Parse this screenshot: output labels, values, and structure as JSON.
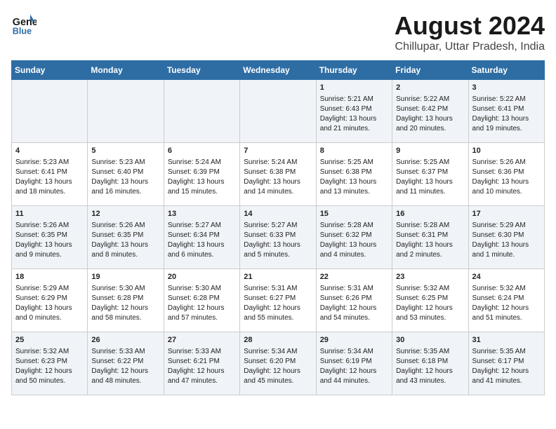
{
  "header": {
    "logo_line1": "General",
    "logo_line2": "Blue",
    "month_year": "August 2024",
    "location": "Chillupar, Uttar Pradesh, India"
  },
  "days_of_week": [
    "Sunday",
    "Monday",
    "Tuesday",
    "Wednesday",
    "Thursday",
    "Friday",
    "Saturday"
  ],
  "weeks": [
    [
      {
        "day": "",
        "info": ""
      },
      {
        "day": "",
        "info": ""
      },
      {
        "day": "",
        "info": ""
      },
      {
        "day": "",
        "info": ""
      },
      {
        "day": "1",
        "info": "Sunrise: 5:21 AM\nSunset: 6:43 PM\nDaylight: 13 hours\nand 21 minutes."
      },
      {
        "day": "2",
        "info": "Sunrise: 5:22 AM\nSunset: 6:42 PM\nDaylight: 13 hours\nand 20 minutes."
      },
      {
        "day": "3",
        "info": "Sunrise: 5:22 AM\nSunset: 6:41 PM\nDaylight: 13 hours\nand 19 minutes."
      }
    ],
    [
      {
        "day": "4",
        "info": "Sunrise: 5:23 AM\nSunset: 6:41 PM\nDaylight: 13 hours\nand 18 minutes."
      },
      {
        "day": "5",
        "info": "Sunrise: 5:23 AM\nSunset: 6:40 PM\nDaylight: 13 hours\nand 16 minutes."
      },
      {
        "day": "6",
        "info": "Sunrise: 5:24 AM\nSunset: 6:39 PM\nDaylight: 13 hours\nand 15 minutes."
      },
      {
        "day": "7",
        "info": "Sunrise: 5:24 AM\nSunset: 6:38 PM\nDaylight: 13 hours\nand 14 minutes."
      },
      {
        "day": "8",
        "info": "Sunrise: 5:25 AM\nSunset: 6:38 PM\nDaylight: 13 hours\nand 13 minutes."
      },
      {
        "day": "9",
        "info": "Sunrise: 5:25 AM\nSunset: 6:37 PM\nDaylight: 13 hours\nand 11 minutes."
      },
      {
        "day": "10",
        "info": "Sunrise: 5:26 AM\nSunset: 6:36 PM\nDaylight: 13 hours\nand 10 minutes."
      }
    ],
    [
      {
        "day": "11",
        "info": "Sunrise: 5:26 AM\nSunset: 6:35 PM\nDaylight: 13 hours\nand 9 minutes."
      },
      {
        "day": "12",
        "info": "Sunrise: 5:26 AM\nSunset: 6:35 PM\nDaylight: 13 hours\nand 8 minutes."
      },
      {
        "day": "13",
        "info": "Sunrise: 5:27 AM\nSunset: 6:34 PM\nDaylight: 13 hours\nand 6 minutes."
      },
      {
        "day": "14",
        "info": "Sunrise: 5:27 AM\nSunset: 6:33 PM\nDaylight: 13 hours\nand 5 minutes."
      },
      {
        "day": "15",
        "info": "Sunrise: 5:28 AM\nSunset: 6:32 PM\nDaylight: 13 hours\nand 4 minutes."
      },
      {
        "day": "16",
        "info": "Sunrise: 5:28 AM\nSunset: 6:31 PM\nDaylight: 13 hours\nand 2 minutes."
      },
      {
        "day": "17",
        "info": "Sunrise: 5:29 AM\nSunset: 6:30 PM\nDaylight: 13 hours\nand 1 minute."
      }
    ],
    [
      {
        "day": "18",
        "info": "Sunrise: 5:29 AM\nSunset: 6:29 PM\nDaylight: 13 hours\nand 0 minutes."
      },
      {
        "day": "19",
        "info": "Sunrise: 5:30 AM\nSunset: 6:28 PM\nDaylight: 12 hours\nand 58 minutes."
      },
      {
        "day": "20",
        "info": "Sunrise: 5:30 AM\nSunset: 6:28 PM\nDaylight: 12 hours\nand 57 minutes."
      },
      {
        "day": "21",
        "info": "Sunrise: 5:31 AM\nSunset: 6:27 PM\nDaylight: 12 hours\nand 55 minutes."
      },
      {
        "day": "22",
        "info": "Sunrise: 5:31 AM\nSunset: 6:26 PM\nDaylight: 12 hours\nand 54 minutes."
      },
      {
        "day": "23",
        "info": "Sunrise: 5:32 AM\nSunset: 6:25 PM\nDaylight: 12 hours\nand 53 minutes."
      },
      {
        "day": "24",
        "info": "Sunrise: 5:32 AM\nSunset: 6:24 PM\nDaylight: 12 hours\nand 51 minutes."
      }
    ],
    [
      {
        "day": "25",
        "info": "Sunrise: 5:32 AM\nSunset: 6:23 PM\nDaylight: 12 hours\nand 50 minutes."
      },
      {
        "day": "26",
        "info": "Sunrise: 5:33 AM\nSunset: 6:22 PM\nDaylight: 12 hours\nand 48 minutes."
      },
      {
        "day": "27",
        "info": "Sunrise: 5:33 AM\nSunset: 6:21 PM\nDaylight: 12 hours\nand 47 minutes."
      },
      {
        "day": "28",
        "info": "Sunrise: 5:34 AM\nSunset: 6:20 PM\nDaylight: 12 hours\nand 45 minutes."
      },
      {
        "day": "29",
        "info": "Sunrise: 5:34 AM\nSunset: 6:19 PM\nDaylight: 12 hours\nand 44 minutes."
      },
      {
        "day": "30",
        "info": "Sunrise: 5:35 AM\nSunset: 6:18 PM\nDaylight: 12 hours\nand 43 minutes."
      },
      {
        "day": "31",
        "info": "Sunrise: 5:35 AM\nSunset: 6:17 PM\nDaylight: 12 hours\nand 41 minutes."
      }
    ]
  ]
}
